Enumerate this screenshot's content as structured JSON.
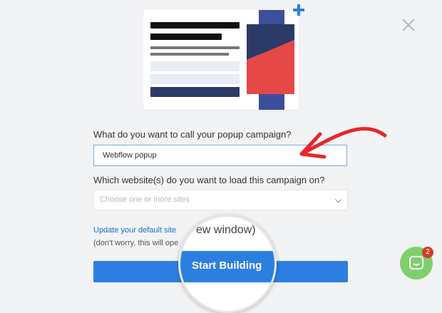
{
  "labels": {
    "name_question": "What do you want to call your popup campaign?",
    "site_question": "Which website(s) do you want to load this campaign on?"
  },
  "inputs": {
    "campaign_name_value": "Webflow popup",
    "site_placeholder": "Choose one or more sites"
  },
  "links": {
    "update_default_site": "Update your default site",
    "note_partial": "(don't worry, this will ope"
  },
  "magnifier": {
    "text_partial": "ew window)",
    "button_label": "Start Building"
  },
  "chat": {
    "badge_count": "2"
  },
  "colors": {
    "primary_blue": "#2c7fe0",
    "arrow_red": "#e8262b",
    "navy": "#2b3a67",
    "accent_red": "#e64848",
    "chat_green": "#7fd06b"
  },
  "icons": [
    "plus-icon",
    "close-icon",
    "chevron-down-icon",
    "chat-icon"
  ]
}
